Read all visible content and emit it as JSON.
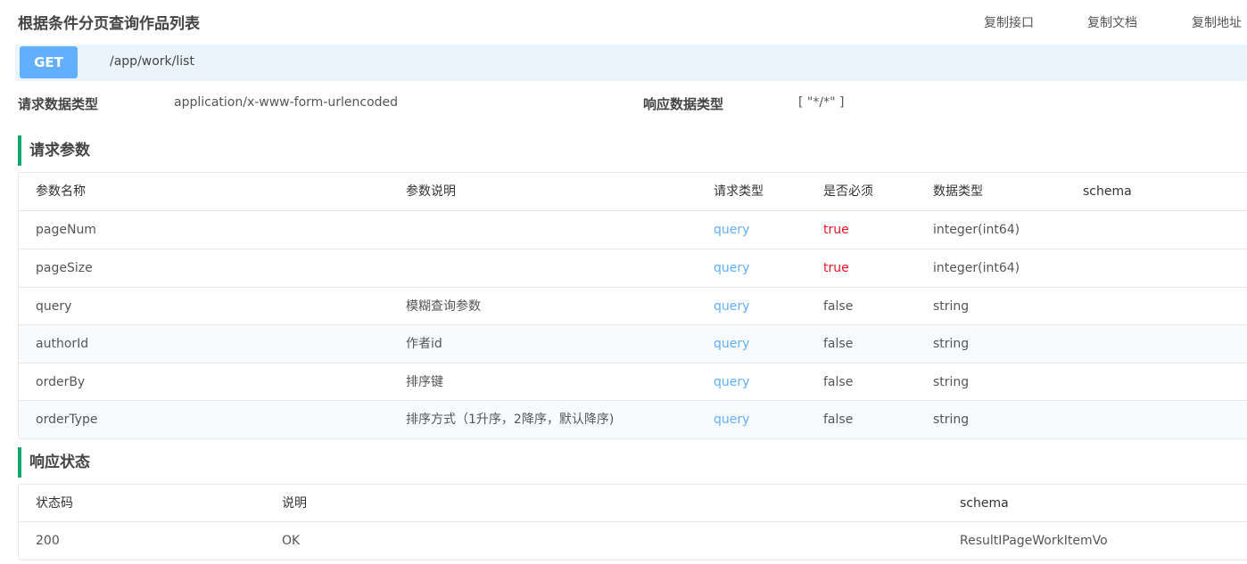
{
  "header": {
    "title": "根据条件分页查询作品列表",
    "actions": [
      {
        "label": "复制接口"
      },
      {
        "label": "复制文档"
      },
      {
        "label": "复制地址"
      }
    ]
  },
  "endpoint": {
    "method": "GET",
    "path": "/app/work/list",
    "method_color": "#61affe"
  },
  "meta": {
    "request_type_label": "请求数据类型",
    "request_type_value": "application/x-www-form-urlencoded",
    "response_type_label": "响应数据类型",
    "response_type_value": "[ \"*/*\" ]"
  },
  "params": {
    "heading": "请求参数",
    "columns": [
      "参数名称",
      "参数说明",
      "请求类型",
      "是否必须",
      "数据类型",
      "schema"
    ],
    "rows": [
      {
        "name": "pageNum",
        "desc": "",
        "in": "query",
        "required": "true",
        "type": "integer(int64)",
        "schema": ""
      },
      {
        "name": "pageSize",
        "desc": "",
        "in": "query",
        "required": "true",
        "type": "integer(int64)",
        "schema": ""
      },
      {
        "name": "query",
        "desc": "模糊查询参数",
        "in": "query",
        "required": "false",
        "type": "string",
        "schema": ""
      },
      {
        "name": "authorId",
        "desc": "作者id",
        "in": "query",
        "required": "false",
        "type": "string",
        "schema": ""
      },
      {
        "name": "orderBy",
        "desc": "排序键",
        "in": "query",
        "required": "false",
        "type": "string",
        "schema": ""
      },
      {
        "name": "orderType",
        "desc": "排序方式（1升序，2降序，默认降序)",
        "in": "query",
        "required": "false",
        "type": "string",
        "schema": ""
      }
    ]
  },
  "responses": {
    "heading": "响应状态",
    "columns": [
      "状态码",
      "说明",
      "schema"
    ],
    "rows": [
      {
        "code": "200",
        "desc": "OK",
        "schema": "ResultIPageWorkItemVo"
      }
    ]
  },
  "colors": {
    "accent_green": "#14a76c",
    "link_blue": "#61affe",
    "required_red": "#e81123",
    "endpoint_bg": "#eaf4fc"
  }
}
